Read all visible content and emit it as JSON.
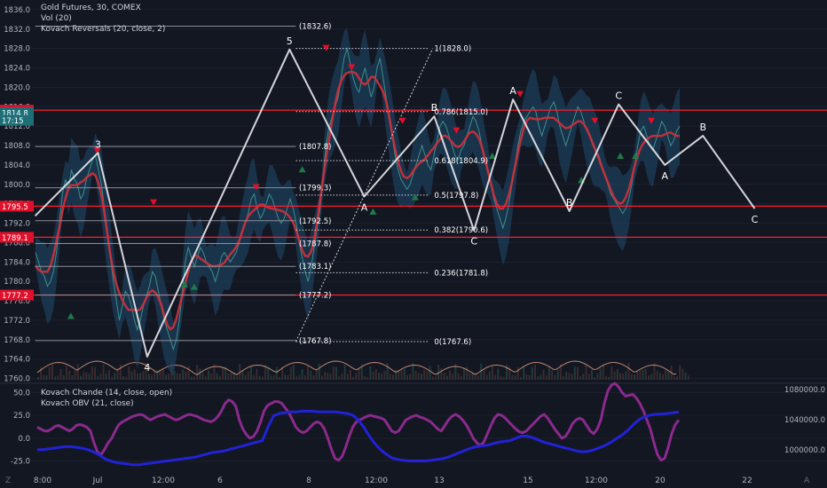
{
  "header": {
    "title": "Gold Futures, 30, COMEX",
    "indicators": [
      "Vol (20)",
      "Kovach Reversals (20, close, 2)"
    ]
  },
  "subpanel": {
    "indicators": [
      "Kovach Chande (14, close, open)",
      "Kovach OBV (21, close)"
    ]
  },
  "price_axis": {
    "ticks": [
      "1836.0",
      "1832.0",
      "1828.0",
      "1824.0",
      "1820.0",
      "1816.0",
      "1812.0",
      "1808.0",
      "1804.0",
      "1800.0",
      "1796.0",
      "1792.0",
      "1788.0",
      "1784.0",
      "1780.0",
      "1776.0",
      "1772.0",
      "1768.0",
      "1764.0",
      "1760.0"
    ],
    "badges": [
      {
        "label": "1815.3",
        "color": "#e0102a"
      },
      {
        "label": "1814.8",
        "color": "#1e6e78"
      },
      {
        "label": "17:15",
        "color": "#1e6e78"
      },
      {
        "label": "1795.5",
        "color": "#e0102a"
      },
      {
        "label": "1789.1",
        "color": "#e0102a"
      },
      {
        "label": "1777.2",
        "color": "#e0102a"
      }
    ]
  },
  "sub_axis": {
    "left_ticks": [
      "50.0",
      "25.0",
      "0.0",
      "-25.0"
    ],
    "right_ticks": [
      "1080000.0",
      "1040000.0",
      "1000000.0"
    ]
  },
  "time_axis": {
    "ticks": [
      "8:00",
      "Jul",
      "12:00",
      "6",
      "8",
      "12:00",
      "13",
      "15",
      "12:00",
      "20",
      "22"
    ]
  },
  "chart_data": [
    {
      "type": "line",
      "name": "main",
      "ylim": [
        1759,
        1838
      ],
      "xlim": [
        0,
        100
      ],
      "horizontal_lines": [
        1815.3,
        1795.5,
        1789.1,
        1777.2
      ],
      "fib_levels": [
        {
          "label": "1(1828.0)",
          "value": 1828.0
        },
        {
          "label": "0.786(1815.0)",
          "value": 1815.0
        },
        {
          "label": "0.618(1804.9)",
          "value": 1804.9
        },
        {
          "label": "0.5(1797.8)",
          "value": 1797.8
        },
        {
          "label": "0.382(1790.6)",
          "value": 1790.6
        },
        {
          "label": "0.236(1781.8)",
          "value": 1781.8
        },
        {
          "label": "0(1767.6)",
          "value": 1767.6
        }
      ],
      "fib_left_labels": [
        {
          "label": "(1832.6)",
          "value": 1832.6
        },
        {
          "label": "(1807.8)",
          "value": 1807.8
        },
        {
          "label": "(1799.3)",
          "value": 1799.3
        },
        {
          "label": "(1792.5)",
          "value": 1792.5
        },
        {
          "label": "(1787.8)",
          "value": 1787.8
        },
        {
          "label": "(1783.1)",
          "value": 1783.1
        },
        {
          "label": "(1777.2)",
          "value": 1777.2
        },
        {
          "label": "(1767.8)",
          "value": 1767.8
        }
      ],
      "wave": [
        {
          "x": 0.4,
          "y": 1793.5,
          "label": ""
        },
        {
          "x": 8.3,
          "y": 1806.5,
          "label": "3"
        },
        {
          "x": 14.5,
          "y": 1764.5,
          "label": "4"
        },
        {
          "x": 32.4,
          "y": 1827.8,
          "label": "5"
        },
        {
          "x": 41.8,
          "y": 1797.5,
          "label": "A"
        },
        {
          "x": 50.6,
          "y": 1814.0,
          "label": "B"
        },
        {
          "x": 55.6,
          "y": 1790.5,
          "label": "C"
        },
        {
          "x": 60.5,
          "y": 1817.5,
          "label": "A"
        },
        {
          "x": 67.6,
          "y": 1794.5,
          "label": "B"
        },
        {
          "x": 73.8,
          "y": 1816.5,
          "label": "C"
        },
        {
          "x": 79.6,
          "y": 1804.0,
          "label": "A"
        },
        {
          "x": 84.4,
          "y": 1810.0,
          "label": "B"
        },
        {
          "x": 90.9,
          "y": 1795.0,
          "label": "C"
        }
      ],
      "close": [
        1786,
        1784,
        1782,
        1781,
        1779,
        1780,
        1782,
        1786,
        1792,
        1798,
        1801,
        1799,
        1803,
        1801,
        1800,
        1797,
        1798,
        1801,
        1803,
        1805,
        1806,
        1803,
        1800,
        1795,
        1790,
        1785,
        1780,
        1776,
        1772,
        1775,
        1778,
        1777,
        1775,
        1772,
        1770,
        1772,
        1775,
        1777,
        1779,
        1782,
        1781,
        1778,
        1775,
        1772,
        1770,
        1768,
        1766,
        1768,
        1772,
        1778,
        1784,
        1787,
        1785,
        1783,
        1785,
        1787,
        1786,
        1784,
        1783,
        1782,
        1780,
        1782,
        1785,
        1786,
        1785,
        1784,
        1785,
        1786,
        1788,
        1790,
        1792,
        1794,
        1797,
        1798,
        1795,
        1793,
        1794,
        1796,
        1798,
        1797,
        1795,
        1793,
        1792,
        1793,
        1795,
        1797,
        1795,
        1792,
        1788,
        1785,
        1782,
        1780,
        1783,
        1787,
        1791,
        1795,
        1802,
        1808,
        1812,
        1814,
        1816,
        1818,
        1822,
        1826,
        1828,
        1825,
        1822,
        1820,
        1819,
        1822,
        1824,
        1821,
        1818,
        1820,
        1824,
        1826,
        1822,
        1818,
        1814,
        1810,
        1806,
        1803,
        1801,
        1800,
        1799,
        1800,
        1802,
        1804,
        1806,
        1808,
        1806,
        1804,
        1803,
        1806,
        1809,
        1812,
        1813,
        1812,
        1810,
        1808,
        1806,
        1805,
        1807,
        1808,
        1810,
        1812,
        1814,
        1813,
        1811,
        1808,
        1805,
        1803,
        1800,
        1797,
        1795,
        1793,
        1791,
        1793,
        1796,
        1800,
        1804,
        1808,
        1811,
        1813,
        1814,
        1815,
        1816,
        1815,
        1812,
        1810,
        1812,
        1814,
        1816,
        1817,
        1815,
        1812,
        1810,
        1808,
        1810,
        1812,
        1814,
        1816,
        1815,
        1813,
        1811,
        1810,
        1808,
        1807,
        1806,
        1804,
        1802,
        1800,
        1798,
        1797,
        1796,
        1795,
        1794,
        1795,
        1797,
        1800,
        1804,
        1808,
        1811,
        1812,
        1810,
        1808,
        1807,
        1809,
        1811,
        1813,
        1812,
        1810,
        1808,
        1809,
        1811,
        1812
      ]
    },
    {
      "type": "line",
      "name": "subpanel",
      "ylim": [
        -33,
        60
      ],
      "y2lim": [
        975000,
        1088000
      ],
      "series": [
        {
          "name": "Kovach Chande (14, close, open)",
          "axis": "left",
          "values": [
            12,
            10,
            8,
            8,
            10,
            13,
            14,
            12,
            10,
            8,
            10,
            14,
            15,
            14,
            12,
            8,
            -5,
            -15,
            -18,
            -12,
            -5,
            0,
            8,
            15,
            18,
            20,
            22,
            24,
            25,
            26,
            25,
            22,
            20,
            22,
            24,
            25,
            26,
            24,
            22,
            20,
            21,
            23,
            25,
            26,
            25,
            24,
            22,
            20,
            19,
            18,
            20,
            24,
            30,
            38,
            42,
            40,
            35,
            20,
            10,
            4,
            0,
            2,
            8,
            18,
            30,
            36,
            38,
            40,
            40,
            38,
            33,
            28,
            20,
            12,
            8,
            6,
            8,
            12,
            16,
            18,
            16,
            10,
            0,
            -12,
            -22,
            -24,
            -20,
            -10,
            2,
            12,
            18,
            20,
            22,
            24,
            25,
            24,
            23,
            22,
            20,
            14,
            8,
            6,
            8,
            14,
            20,
            22,
            24,
            25,
            23,
            22,
            20,
            18,
            14,
            10,
            8,
            14,
            20,
            24,
            26,
            24,
            20,
            15,
            8,
            0,
            -5,
            -8,
            -4,
            5,
            14,
            22,
            26,
            25,
            22,
            18,
            14,
            10,
            7,
            6,
            8,
            12,
            16,
            20,
            24,
            26,
            22,
            16,
            10,
            5,
            0,
            2,
            8,
            16,
            20,
            22,
            20,
            14,
            8,
            5,
            10,
            20,
            38,
            52,
            58,
            60,
            56,
            50,
            46,
            47,
            48,
            44,
            38,
            30,
            20,
            10,
            -5,
            -18,
            -24,
            -22,
            -10,
            5,
            15,
            20
          ]
        },
        {
          "name": "Kovach OBV (21, close)",
          "axis": "right",
          "values": [
            1000000,
            1000000,
            1001000,
            1002000,
            1003000,
            1004000,
            1004000,
            1003000,
            1002000,
            1000000,
            997000,
            993000,
            988000,
            985000,
            983000,
            982000,
            981000,
            980000,
            980000,
            981000,
            982000,
            983000,
            984000,
            985000,
            986000,
            987000,
            988000,
            989000,
            990000,
            992000,
            994000,
            996000,
            997000,
            998000,
            1000000,
            1002000,
            1004000,
            1006000,
            1008000,
            1010000,
            1012000,
            1030000,
            1045000,
            1048000,
            1049000,
            1050000,
            1050000,
            1051000,
            1051000,
            1051000,
            1050000,
            1050000,
            1050000,
            1050000,
            1049000,
            1048000,
            1046000,
            1040000,
            1030000,
            1018000,
            1008000,
            1000000,
            994000,
            989000,
            987000,
            986000,
            985000,
            985000,
            985000,
            985000,
            986000,
            987000,
            988000,
            990000,
            993000,
            996000,
            999000,
            1002000,
            1004000,
            1005000,
            1006000,
            1008000,
            1010000,
            1011000,
            1012000,
            1015000,
            1018000,
            1018000,
            1016000,
            1013000,
            1010000,
            1008000,
            1006000,
            1004000,
            1002000,
            1000000,
            998000,
            997000,
            998000,
            1000000,
            1003000,
            1006000,
            1010000,
            1015000,
            1020000,
            1026000,
            1034000,
            1040000,
            1044000,
            1046000,
            1047000,
            1047000,
            1048000,
            1049000,
            1050000
          ]
        }
      ]
    }
  ]
}
